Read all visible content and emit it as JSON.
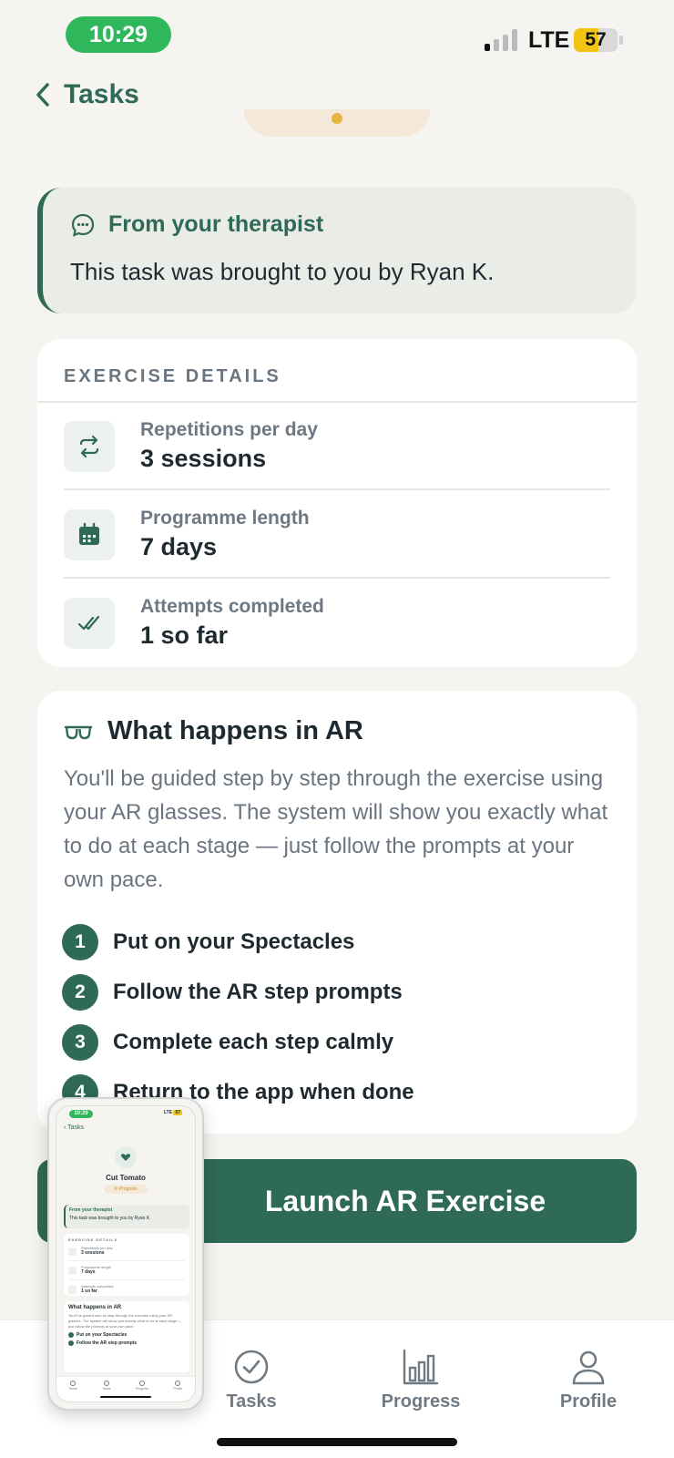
{
  "status_bar": {
    "time": "10:29",
    "network": "LTE",
    "battery": "57",
    "battery_level": 0.57
  },
  "nav": {
    "back_label": "Tasks"
  },
  "therapist": {
    "title": "From your therapist",
    "message": "This task was brought to you by Ryan K."
  },
  "details": {
    "section_label": "EXERCISE DETAILS",
    "items": [
      {
        "label": "Repetitions per day",
        "value": "3 sessions",
        "icon": "repeat-icon"
      },
      {
        "label": "Programme length",
        "value": "7 days",
        "icon": "calendar-icon"
      },
      {
        "label": "Attempts completed",
        "value": "1 so far",
        "icon": "double-check-icon"
      }
    ]
  },
  "ar": {
    "icon": "glasses-icon",
    "title": "What happens in AR",
    "description": "You'll be guided step by step through the exercise using your AR glasses. The system will show you exactly what to do at each stage — just follow the prompts at your own pace.",
    "steps": [
      {
        "num": "1",
        "text": "Put on your Spectacles"
      },
      {
        "num": "2",
        "text": "Follow the AR step prompts"
      },
      {
        "num": "3",
        "text": "Complete each step calmly"
      },
      {
        "num": "4",
        "text": "Return to the app when done"
      }
    ]
  },
  "launch_button": {
    "label": "Launch AR Exercise"
  },
  "tabbar": {
    "tasks": "Tasks",
    "progress": "Progress",
    "profile": "Profile"
  },
  "preview": {
    "time": "10:29",
    "network": "LTE",
    "battery": "57",
    "back_label": "Tasks",
    "title": "Cut Tomato",
    "badge": "In Progress",
    "therapist_title": "From your therapist",
    "therapist_message": "This task was brought to you by Ryan K.",
    "details_label": "EXERCISE DETAILS",
    "rows": [
      {
        "label": "Repetitions per day",
        "value": "3 sessions"
      },
      {
        "label": "Programme length",
        "value": "7 days"
      },
      {
        "label": "Attempts completed",
        "value": "1 so far"
      }
    ],
    "ar_title": "What happens in AR",
    "ar_desc": "You'll be guided step by step through the exercise using your AR glasses. The system will show you exactly what to do at each stage — just follow the prompts at your own pace.",
    "ar_steps": [
      "Put on your Spectacles",
      "Follow the AR step prompts"
    ],
    "tabs": [
      "Home",
      "Tasks",
      "Progress",
      "Profile"
    ]
  },
  "colors": {
    "accent": "#2e6a55",
    "status_green": "#2fb75c",
    "battery_yellow": "#f2c514"
  }
}
